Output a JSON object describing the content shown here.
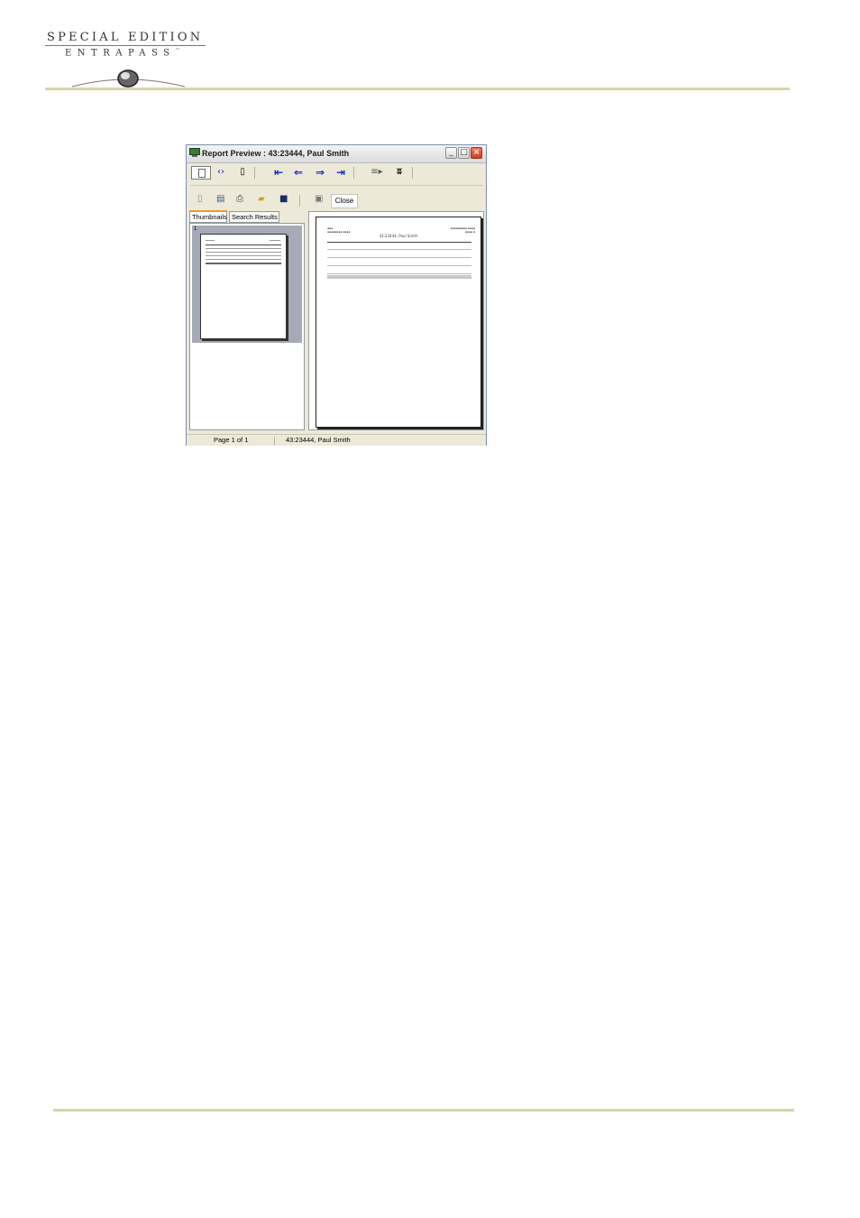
{
  "header": {
    "brand_line1": "SPECIAL EDITION",
    "brand_line2": "ENTRAPASS",
    "trademark": "™"
  },
  "window": {
    "title": "Report Preview : 43:23444, Paul Smith",
    "tabs": [
      "Thumbnails",
      "Search Results"
    ],
    "close_label": "Close",
    "thumbnail_number": "1",
    "status_page": "Page 1 of 1",
    "status_report": "43:23444, Paul Smith"
  },
  "report_page": {
    "title": "43:23444, Paul Smith"
  },
  "colors": {
    "rule": "#d8d6a3",
    "nav_arrow": "#1226c7",
    "close_button": "#d13b1e"
  }
}
